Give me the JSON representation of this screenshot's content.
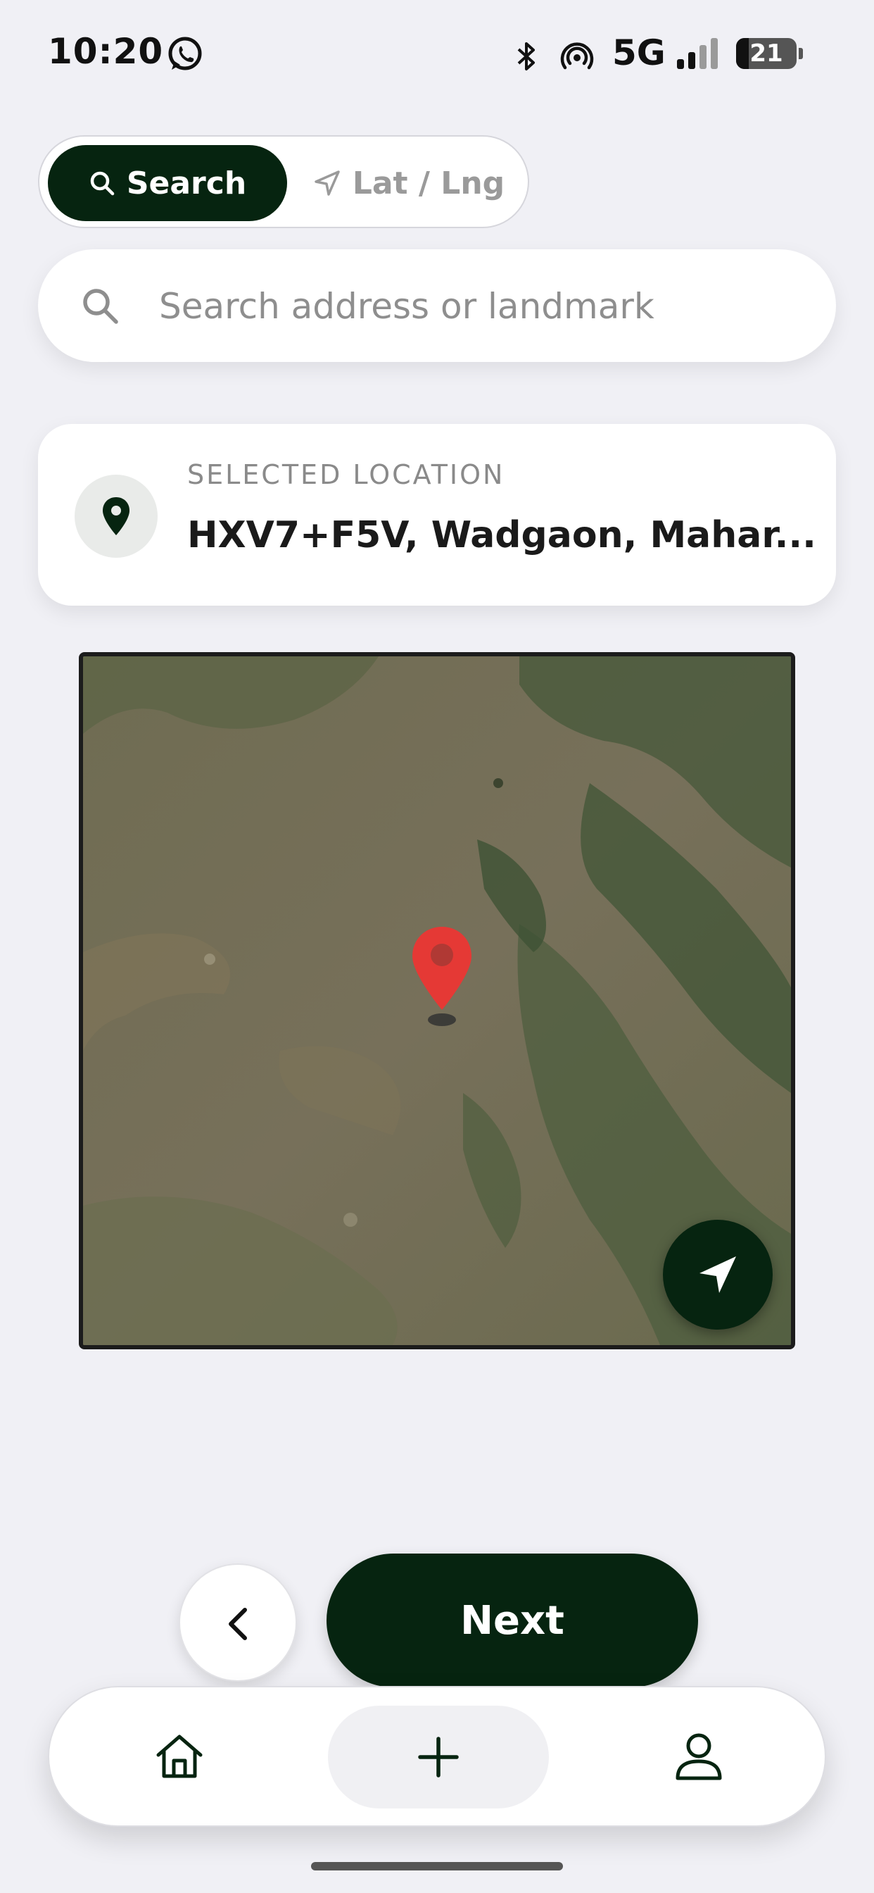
{
  "status_bar": {
    "time": "10:20",
    "network": "5G",
    "battery_level": 21,
    "battery_text": "21",
    "icons": [
      "whatsapp-icon",
      "bluetooth-icon",
      "hotspot-icon",
      "signal-icon",
      "battery-icon"
    ]
  },
  "mode_toggle": {
    "active": "Search",
    "options": [
      {
        "label": "Search",
        "icon": "search-icon"
      },
      {
        "label": "Lat / Lng",
        "icon": "navigation-arrow-icon"
      }
    ]
  },
  "search": {
    "placeholder": "Search address or landmark",
    "value": "",
    "icon": "search-icon"
  },
  "selected_location": {
    "label": "SELECTED LOCATION",
    "value": "HXV7+F5V, Wadgaon, Mahar...",
    "icon": "map-pin-icon"
  },
  "map": {
    "view": "satellite",
    "marker_icon": "map-marker-icon",
    "locate_icon": "navigation-arrow-icon"
  },
  "actions": {
    "back_icon": "chevron-left-icon",
    "next_label": "Next"
  },
  "tab_bar": {
    "items": [
      {
        "name": "home",
        "icon": "home-icon"
      },
      {
        "name": "add",
        "icon": "plus-icon",
        "active": true
      },
      {
        "name": "profile",
        "icon": "user-icon"
      }
    ]
  },
  "colors": {
    "primary": "#062410",
    "background": "#f0f0f5",
    "marker": "#e53935",
    "placeholder": "#8e8e8e"
  }
}
